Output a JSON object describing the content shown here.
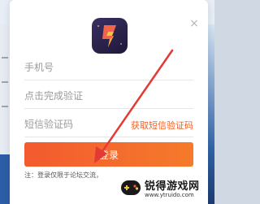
{
  "modal": {
    "close_label": "×",
    "phone_placeholder": "手机号",
    "captcha_placeholder": "点击完成验证",
    "sms_placeholder": "短信验证码",
    "sms_link": "获取短信验证码",
    "login_label": "登录",
    "note": "注：登录仅限于论坛交流，"
  },
  "watermark": {
    "title": "锐得游戏网",
    "url": "www.ytruido.com"
  },
  "colors": {
    "accent": "#f35a2f",
    "annotation": "#e53935"
  }
}
